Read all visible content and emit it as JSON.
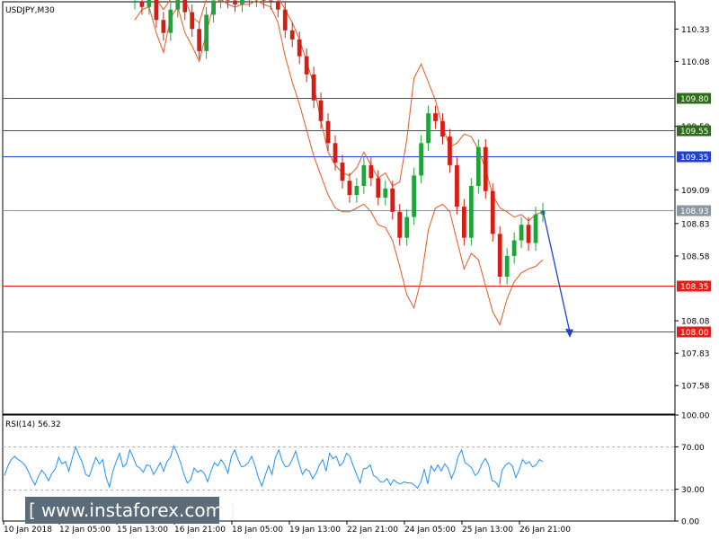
{
  "chart_data": [
    {
      "type": "line",
      "title": "USDJPY,M30",
      "y_ticks": [
        "110.33",
        "110.08",
        "109.58",
        "109.09",
        "108.83",
        "108.58",
        "108.08",
        "107.83",
        "107.58"
      ],
      "x_ticks": [
        "10 Jan 2018",
        "12 Jan 05:00",
        "15 Jan 13:00",
        "16 Jan 21:00",
        "18 Jan 05:00",
        "19 Jan 13:00",
        "22 Jan 21:00",
        "24 Jan 05:00",
        "25 Jan 13:00",
        "26 Jan 21:00"
      ],
      "ylim": [
        107.36,
        110.54
      ],
      "levels": [
        {
          "label": "109.80",
          "value": 109.8,
          "color": "#2e6b1a"
        },
        {
          "label": "109.55",
          "value": 109.55,
          "color": "#2e6b1a"
        },
        {
          "label": "109.35",
          "value": 109.35,
          "color": "#1f3fd6"
        },
        {
          "label": "108.93",
          "value": 108.93,
          "color": "#8a97a3"
        },
        {
          "label": "108.35",
          "value": 108.35,
          "color": "#e0201b"
        },
        {
          "label": "108.00",
          "value": 108.0,
          "color": "#e0201b"
        }
      ],
      "series": [
        {
          "values": [
            110.54,
            110.5,
            110.56,
            110.4,
            110.3,
            110.48,
            110.56,
            110.46,
            110.33,
            110.16,
            110.44,
            110.55,
            110.57,
            110.55,
            110.52,
            110.56,
            110.56,
            110.57,
            110.55,
            110.54,
            110.48,
            110.32,
            110.25,
            110.12,
            109.98,
            109.78,
            109.62,
            109.45,
            109.3,
            109.16,
            109.05,
            109.12,
            109.28,
            109.18,
            109.03,
            109.1,
            108.92,
            108.72,
            108.88,
            109.2,
            109.45,
            109.68,
            109.62,
            109.5,
            109.28,
            108.96,
            108.72,
            109.12,
            109.42,
            109.08,
            108.75,
            108.42,
            108.58,
            108.7,
            108.82,
            108.68,
            108.9,
            108.93
          ]
        }
      ],
      "bands": {
        "upper": [
          110.56,
          110.58,
          110.58,
          110.56,
          110.48,
          110.56,
          110.58,
          110.56,
          110.42,
          110.38,
          110.56,
          110.58,
          110.58,
          110.58,
          110.58,
          110.58,
          110.58,
          110.58,
          110.58,
          110.58,
          110.58,
          110.48,
          110.38,
          110.25,
          110.08,
          109.9,
          109.62,
          109.38,
          109.28,
          109.22,
          109.2,
          109.26,
          109.38,
          109.28,
          109.18,
          109.22,
          109.12,
          109.15,
          109.48,
          109.95,
          110.06,
          109.92,
          109.78,
          109.58,
          109.42,
          109.45,
          109.52,
          109.5,
          109.4,
          109.25,
          109.05,
          108.95,
          108.92,
          108.88,
          108.9,
          108.85,
          108.9,
          108.92
        ],
        "lower": [
          110.4,
          110.48,
          110.5,
          110.3,
          110.15,
          110.42,
          110.5,
          110.3,
          110.2,
          110.08,
          110.3,
          110.52,
          110.56,
          110.52,
          110.5,
          110.52,
          110.52,
          110.55,
          110.52,
          110.5,
          110.38,
          110.12,
          109.92,
          109.75,
          109.55,
          109.35,
          109.2,
          109.05,
          108.95,
          108.92,
          108.92,
          108.95,
          108.98,
          108.92,
          108.82,
          108.8,
          108.7,
          108.5,
          108.28,
          108.18,
          108.4,
          108.78,
          108.95,
          108.98,
          108.92,
          108.7,
          108.48,
          108.6,
          108.55,
          108.35,
          108.15,
          108.05,
          108.25,
          108.38,
          108.45,
          108.48,
          108.5,
          108.55
        ]
      },
      "forecast": {
        "from": 108.93,
        "to": 107.95
      }
    },
    {
      "type": "line",
      "title": "RSI(14) 56.32",
      "y_ticks": [
        "100.00",
        "70.00",
        "30.00",
        "0.00"
      ],
      "ylim": [
        0,
        100
      ],
      "levels": [
        70,
        30
      ],
      "series": [
        {
          "values": [
            43,
            52,
            58,
            61,
            58,
            56,
            53,
            47,
            40,
            34,
            42,
            48,
            44,
            38,
            45,
            49,
            60,
            54,
            56,
            47,
            59,
            70,
            62,
            55,
            44,
            42,
            51,
            60,
            54,
            58,
            41,
            32,
            47,
            56,
            64,
            51,
            54,
            67,
            60,
            52,
            50,
            46,
            53,
            52,
            44,
            49,
            55,
            47,
            56,
            60,
            71,
            64,
            55,
            44,
            36,
            39,
            50,
            46,
            48,
            45,
            37,
            47,
            55,
            52,
            58,
            53,
            45,
            61,
            67,
            58,
            51,
            52,
            55,
            61,
            52,
            41,
            33,
            43,
            52,
            44,
            60,
            67,
            57,
            51,
            52,
            58,
            66,
            54,
            44,
            49,
            47,
            40,
            45,
            53,
            58,
            47,
            64,
            59,
            61,
            52,
            55,
            64,
            61,
            52,
            44,
            36,
            49,
            50,
            53,
            43,
            41,
            37,
            37,
            40,
            34,
            39,
            36,
            35,
            37,
            36,
            36,
            34,
            31,
            37,
            49,
            35,
            52,
            47,
            53,
            47,
            54,
            50,
            40,
            48,
            61,
            67,
            55,
            53,
            50,
            43,
            46,
            54,
            59,
            53,
            38,
            37,
            32,
            48,
            53,
            55,
            52,
            41,
            48,
            58,
            54,
            56,
            51,
            53,
            58,
            56
          ]
        }
      ]
    }
  ],
  "watermark": {
    "left": "[",
    "text": "www.instaforex.com",
    "right": "]"
  }
}
